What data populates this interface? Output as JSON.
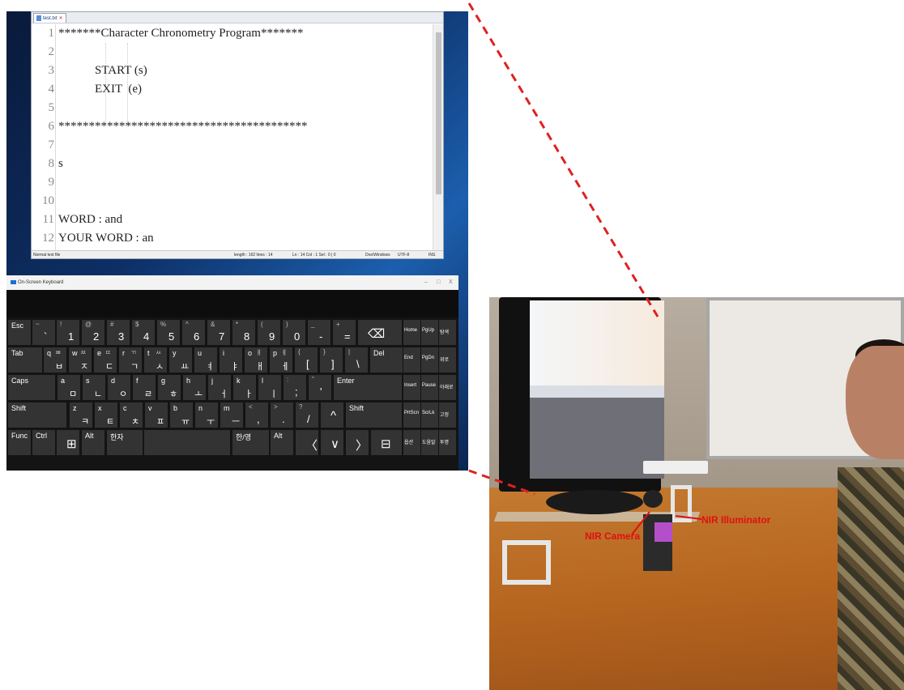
{
  "notepad": {
    "tab_label": "test.txt",
    "lines": [
      {
        "num": "1",
        "text": "*******Character Chronometry Program*******"
      },
      {
        "num": "2",
        "text": ""
      },
      {
        "num": "3",
        "text": "            START (s)"
      },
      {
        "num": "4",
        "text": "            EXIT  (e)"
      },
      {
        "num": "5",
        "text": ""
      },
      {
        "num": "6",
        "text": "*****************************************"
      },
      {
        "num": "7",
        "text": ""
      },
      {
        "num": "8",
        "text": "s"
      },
      {
        "num": "9",
        "text": ""
      },
      {
        "num": "10",
        "text": ""
      },
      {
        "num": "11",
        "text": "WORD : and"
      },
      {
        "num": "12",
        "text": "YOUR WORD : an"
      }
    ],
    "status": {
      "file_type": "Normal text file",
      "length": "length : 162   lines : 14",
      "position": "Ln : 14   Col : 1   Sel : 0 | 0",
      "eol": "Dos\\Windows",
      "encoding": "UTF-8",
      "mode": "INS"
    }
  },
  "keyboard": {
    "title": "On-Screen Keyboard",
    "window_controls": [
      "–",
      "□",
      "X"
    ],
    "rows": [
      [
        {
          "label": "Esc"
        },
        {
          "sub": "~",
          "base": "`"
        },
        {
          "sub": "!",
          "base": "1"
        },
        {
          "sub": "@",
          "base": "2"
        },
        {
          "sub": "#",
          "base": "3"
        },
        {
          "sub": "$",
          "base": "4"
        },
        {
          "sub": "%",
          "base": "5"
        },
        {
          "sub": "^",
          "base": "6"
        },
        {
          "sub": "&",
          "base": "7"
        },
        {
          "sub": "*",
          "base": "8"
        },
        {
          "sub": "(",
          "base": "9"
        },
        {
          "sub": ")",
          "base": "0"
        },
        {
          "sub": "_",
          "base": "-"
        },
        {
          "sub": "+",
          "base": "="
        },
        {
          "label": "⌫"
        }
      ],
      [
        {
          "label": "Tab"
        },
        {
          "label": "q",
          "sub": "ㅃ",
          "base": "ㅂ"
        },
        {
          "label": "w",
          "sub": "ㅉ",
          "base": "ㅈ"
        },
        {
          "label": "e",
          "sub": "ㄸ",
          "base": "ㄷ"
        },
        {
          "label": "r",
          "sub": "ㄲ",
          "base": "ㄱ"
        },
        {
          "label": "t",
          "sub": "ㅆ",
          "base": "ㅅ"
        },
        {
          "label": "y",
          "base": "ㅛ"
        },
        {
          "label": "u",
          "base": "ㅕ"
        },
        {
          "label": "i",
          "base": "ㅑ"
        },
        {
          "label": "o",
          "sub": "ㅒ",
          "base": "ㅐ"
        },
        {
          "label": "p",
          "sub": "ㅖ",
          "base": "ㅔ"
        },
        {
          "sub": "{",
          "base": "["
        },
        {
          "sub": "}",
          "base": "]"
        },
        {
          "sub": "|",
          "base": "\\"
        },
        {
          "label": "Del"
        }
      ],
      [
        {
          "label": "Caps"
        },
        {
          "label": "a",
          "base": "ㅁ"
        },
        {
          "label": "s",
          "base": "ㄴ"
        },
        {
          "label": "d",
          "base": "ㅇ"
        },
        {
          "label": "f",
          "base": "ㄹ"
        },
        {
          "label": "g",
          "base": "ㅎ"
        },
        {
          "label": "h",
          "base": "ㅗ"
        },
        {
          "label": "j",
          "base": "ㅓ"
        },
        {
          "label": "k",
          "base": "ㅏ"
        },
        {
          "label": "l",
          "base": "ㅣ"
        },
        {
          "sub": ":",
          "base": ";"
        },
        {
          "sub": "\"",
          "base": "'"
        },
        {
          "label": "Enter"
        }
      ],
      [
        {
          "label": "Shift"
        },
        {
          "label": "z",
          "base": "ㅋ"
        },
        {
          "label": "x",
          "base": "ㅌ"
        },
        {
          "label": "c",
          "base": "ㅊ"
        },
        {
          "label": "v",
          "base": "ㅍ"
        },
        {
          "label": "b",
          "base": "ㅠ"
        },
        {
          "label": "n",
          "base": "ㅜ"
        },
        {
          "label": "m",
          "base": "ㅡ"
        },
        {
          "sub": "<",
          "base": ","
        },
        {
          "sub": ">",
          "base": "."
        },
        {
          "sub": "?",
          "base": "/"
        },
        {
          "label": "^"
        },
        {
          "label": "Shift"
        }
      ],
      [
        {
          "label": "Func"
        },
        {
          "label": "Ctrl"
        },
        {
          "label": "⊞"
        },
        {
          "label": "Alt"
        },
        {
          "label": "한자"
        },
        {
          "label": ""
        },
        {
          "label": "한/영"
        },
        {
          "label": "Alt"
        },
        {
          "label": "〈"
        },
        {
          "label": "∨"
        },
        {
          "label": "〉"
        },
        {
          "label": "⊟"
        }
      ]
    ],
    "nav_rows": [
      [
        "Home",
        "PgUp",
        "탐색"
      ],
      [
        "End",
        "PgDn",
        "위로"
      ],
      [
        "Insert",
        "Pause",
        "아래로"
      ],
      [
        "PrtScn",
        "ScrLk",
        "고정"
      ],
      [
        "옵션",
        "도움말",
        "투명"
      ]
    ]
  },
  "photo": {
    "labels": {
      "camera": "NIR Camera",
      "illuminator": "NIR Illuminator"
    }
  },
  "colors": {
    "connector": "#e02020",
    "key_bg": "#333333",
    "label_red": "#e01010"
  }
}
